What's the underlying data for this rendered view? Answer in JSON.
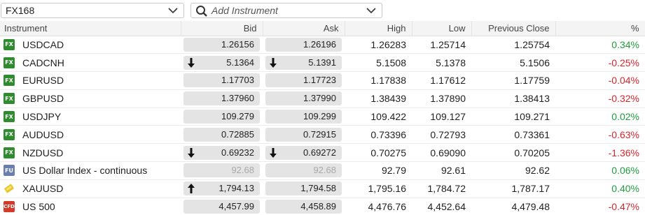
{
  "toolbar": {
    "watchlist": "FX168",
    "add_placeholder": "Add Instrument"
  },
  "columns": {
    "instrument": "Instrument",
    "bid": "Bid",
    "ask": "Ask",
    "high": "High",
    "low": "Low",
    "prev_close": "Previous Close",
    "pct": "%"
  },
  "colors": {
    "up": "#1e9e3c",
    "down": "#d8262e",
    "pill": "#e4e4e4"
  },
  "rows": [
    {
      "badge": "FX",
      "badge_type": "fx",
      "name": "USDCAD",
      "bid": "1.26156",
      "ask": "1.26196",
      "high": "1.26283",
      "low": "1.25714",
      "prev": "1.25754",
      "pct": "0.34%",
      "dir": "pos",
      "tick": "",
      "dim": false
    },
    {
      "badge": "FX",
      "badge_type": "fx",
      "name": "CADCNH",
      "bid": "5.1364",
      "ask": "5.1391",
      "high": "5.1508",
      "low": "5.1378",
      "prev": "5.1506",
      "pct": "-0.25%",
      "dir": "neg",
      "tick": "down",
      "dim": false
    },
    {
      "badge": "FX",
      "badge_type": "fx",
      "name": "EURUSD",
      "bid": "1.17703",
      "ask": "1.17723",
      "high": "1.17838",
      "low": "1.17612",
      "prev": "1.17759",
      "pct": "-0.04%",
      "dir": "neg",
      "tick": "",
      "dim": false
    },
    {
      "badge": "FX",
      "badge_type": "fx",
      "name": "GBPUSD",
      "bid": "1.37960",
      "ask": "1.37990",
      "high": "1.38439",
      "low": "1.37890",
      "prev": "1.38413",
      "pct": "-0.32%",
      "dir": "neg",
      "tick": "",
      "dim": false
    },
    {
      "badge": "FX",
      "badge_type": "fx",
      "name": "USDJPY",
      "bid": "109.279",
      "ask": "109.299",
      "high": "109.422",
      "low": "109.127",
      "prev": "109.271",
      "pct": "0.02%",
      "dir": "pos",
      "tick": "",
      "dim": false
    },
    {
      "badge": "FX",
      "badge_type": "fx",
      "name": "AUDUSD",
      "bid": "0.72885",
      "ask": "0.72915",
      "high": "0.73396",
      "low": "0.72793",
      "prev": "0.73361",
      "pct": "-0.63%",
      "dir": "neg",
      "tick": "",
      "dim": false
    },
    {
      "badge": "FX",
      "badge_type": "fx",
      "name": "NZDUSD",
      "bid": "0.69232",
      "ask": "0.69272",
      "high": "0.70275",
      "low": "0.69090",
      "prev": "0.70205",
      "pct": "-1.36%",
      "dir": "neg",
      "tick": "down",
      "dim": false
    },
    {
      "badge": "FU",
      "badge_type": "fu",
      "name": "US Dollar Index - continuous",
      "bid": "92.68",
      "ask": "92.68",
      "high": "92.79",
      "low": "92.61",
      "prev": "92.62",
      "pct": "0.06%",
      "dir": "pos",
      "tick": "",
      "dim": true
    },
    {
      "badge": "",
      "badge_type": "cm",
      "name": "XAUUSD",
      "bid": "1,794.13",
      "ask": "1,794.58",
      "high": "1,795.16",
      "low": "1,784.72",
      "prev": "1,787.17",
      "pct": "0.40%",
      "dir": "pos",
      "tick": "up",
      "dim": false
    },
    {
      "badge": "CFD",
      "badge_type": "cfd",
      "name": "US 500",
      "bid": "4,457.99",
      "ask": "4,458.89",
      "high": "4,476.76",
      "low": "4,452.64",
      "prev": "4,479.48",
      "pct": "-0.47%",
      "dir": "neg",
      "tick": "",
      "dim": false
    }
  ]
}
